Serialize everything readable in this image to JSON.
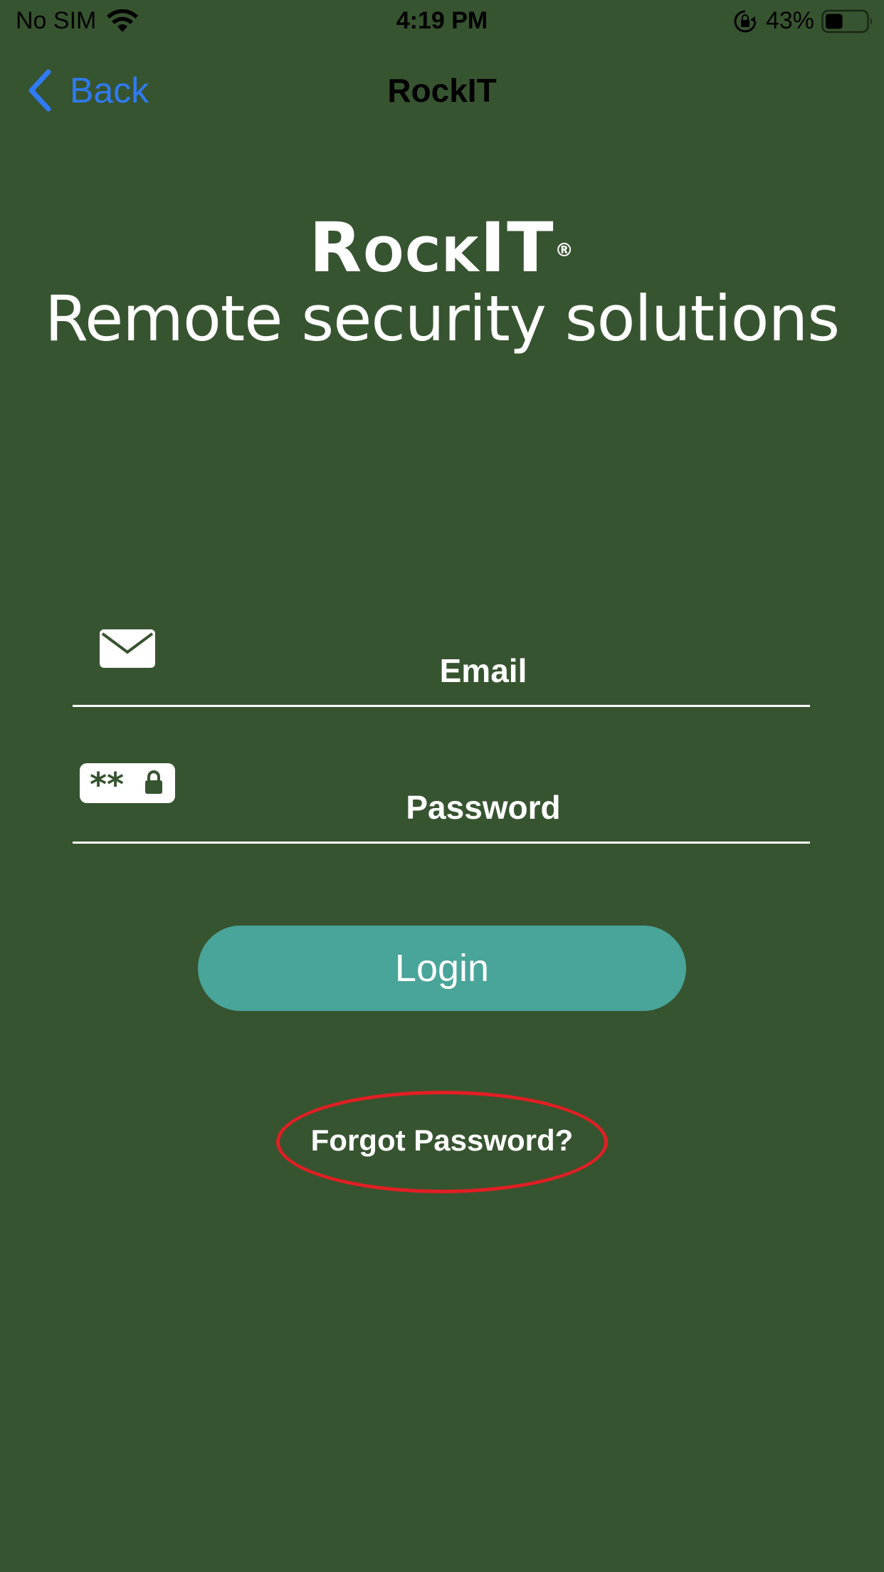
{
  "status_bar": {
    "carrier": "No SIM",
    "time": "4:19 PM",
    "battery_percent": "43%",
    "battery_level": 0.43,
    "icons": [
      "wifi-icon",
      "lock-rotation-icon",
      "battery-icon"
    ]
  },
  "nav": {
    "back_label": "Back",
    "title": "RockIT",
    "back_icon": "chevron-left-icon"
  },
  "logo": {
    "brand": "RockIT",
    "registered_mark": "®",
    "tagline": "Remote security solutions"
  },
  "form": {
    "email_placeholder": "Email",
    "email_value": "",
    "email_icon": "envelope-icon",
    "password_placeholder": "Password",
    "password_value": "",
    "password_icon": "password-icon",
    "login_label": "Login",
    "forgot_label": "Forgot Password?"
  },
  "colors": {
    "background": "#375430",
    "accent_blue": "#2f7bf5",
    "button": "#49a49a",
    "text": "#ffffff",
    "highlight": "#e31e24"
  }
}
